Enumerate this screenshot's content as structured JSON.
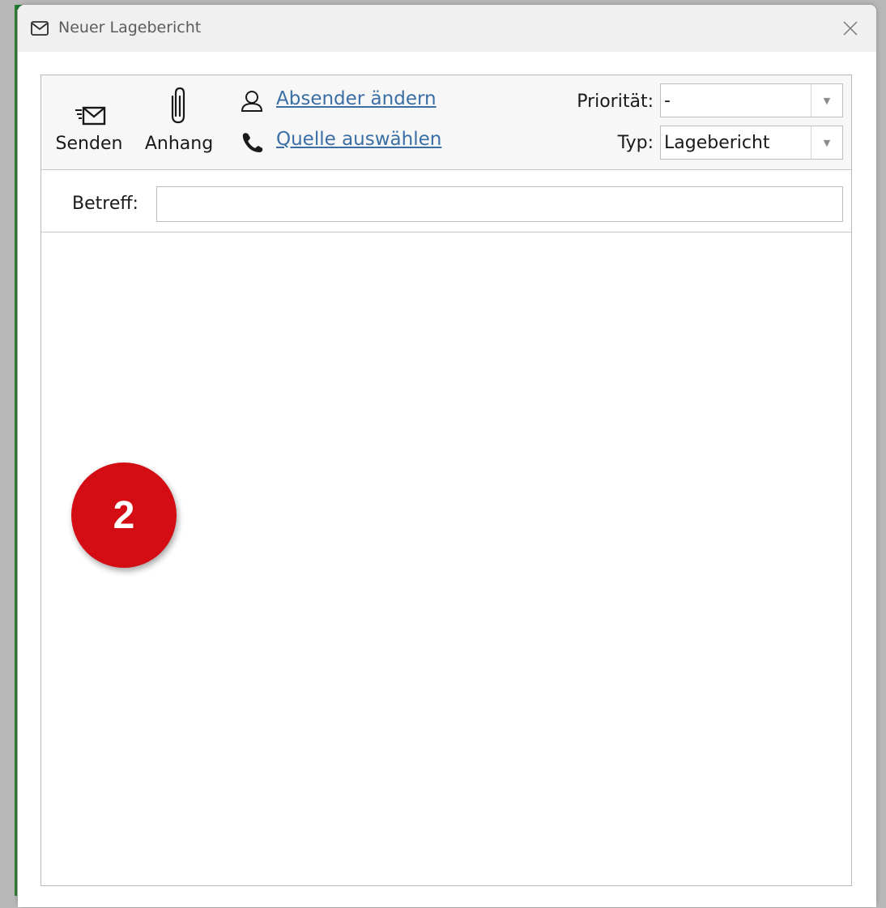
{
  "window": {
    "title": "Neuer Lagebericht",
    "title_icon": "envelope-icon",
    "close_icon": "close-icon"
  },
  "toolbar": {
    "send_label": "Senden",
    "send_icon": "send-mail-icon",
    "attach_label": "Anhang",
    "attach_icon": "paperclip-icon",
    "change_sender_label": "Absender ändern",
    "change_sender_icon": "person-icon",
    "select_source_label": "Quelle auswählen",
    "select_source_icon": "phone-icon"
  },
  "priority": {
    "label": "Priorität:",
    "value": "-"
  },
  "type": {
    "label": "Typ:",
    "value": "Lagebericht"
  },
  "subject": {
    "label": "Betreff:",
    "value": ""
  },
  "marker": {
    "number": "2",
    "color": "#d40d14"
  },
  "colors": {
    "link": "#3a6ea5",
    "accent_green": "#1f7a2e"
  }
}
